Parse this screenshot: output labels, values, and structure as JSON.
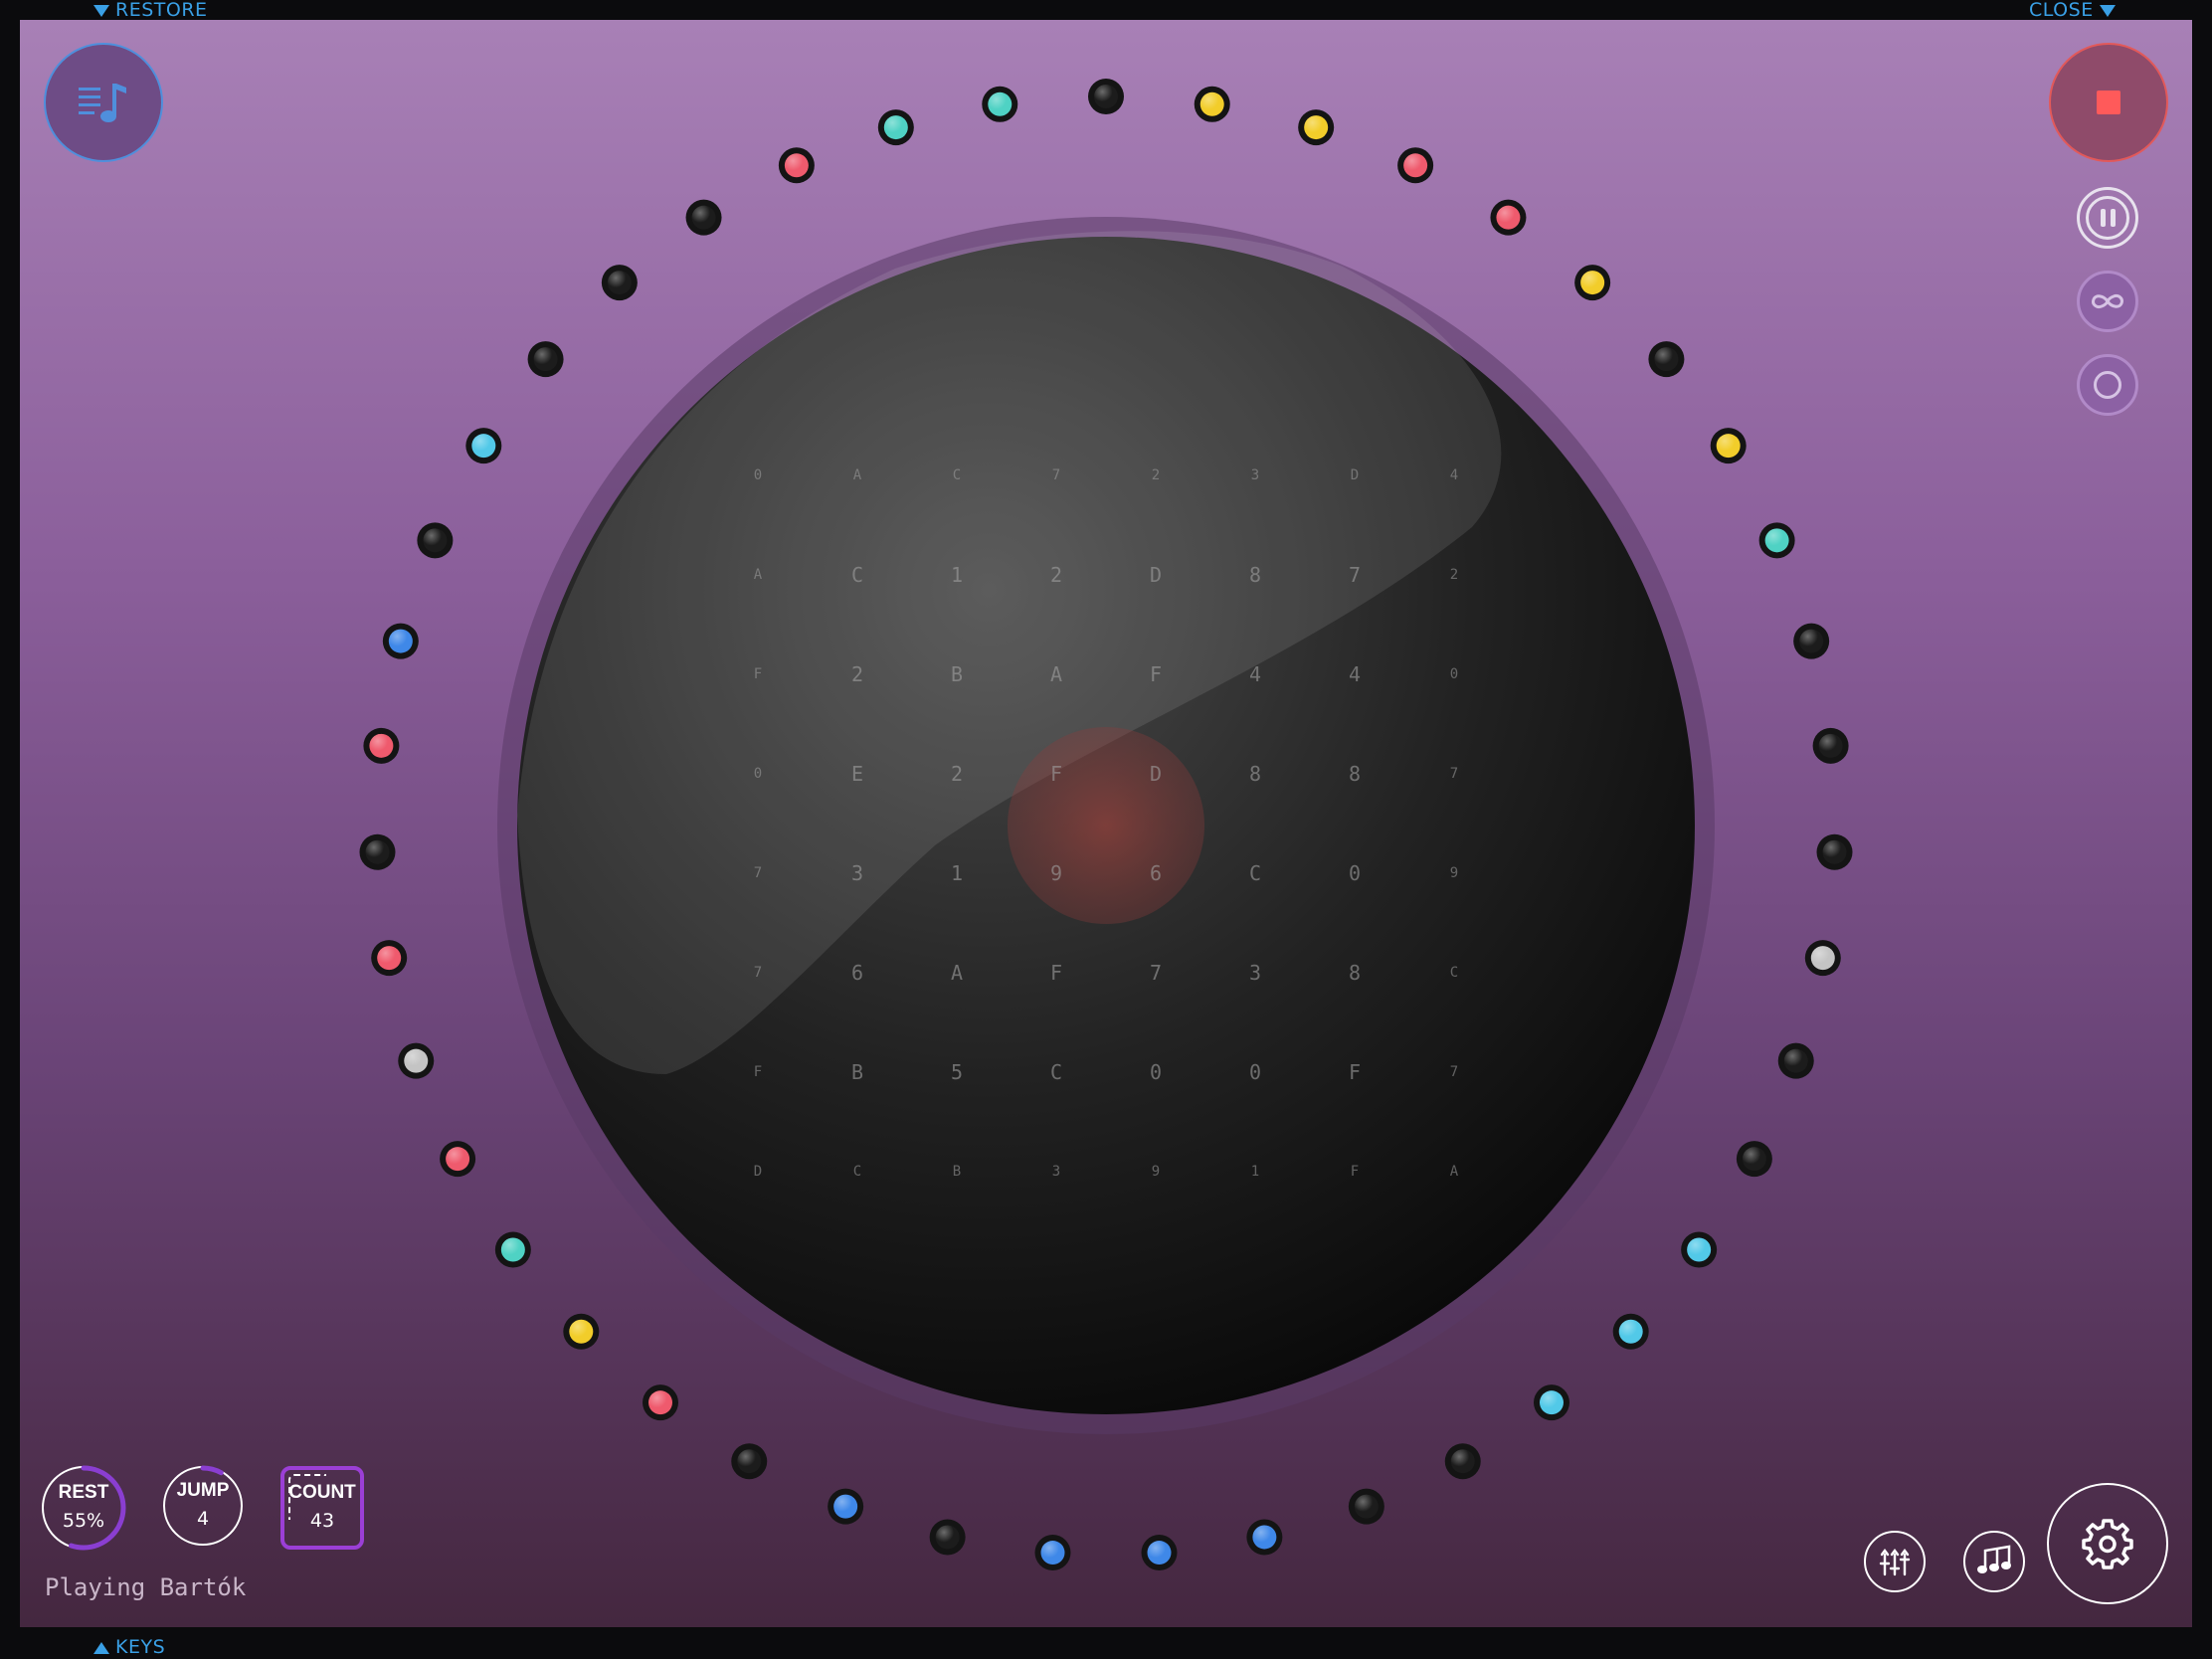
{
  "window": {
    "restore_label": "RESTORE",
    "close_label": "CLOSE",
    "keys_label": "KEYS"
  },
  "status": {
    "text": "Playing Bartók"
  },
  "stats": {
    "rest": {
      "label": "REST",
      "value": "55%",
      "progress": 0.55
    },
    "jump": {
      "label": "JUMP",
      "value": "4",
      "progress": 0.08
    },
    "count": {
      "label": "COUNT",
      "value": "43"
    }
  },
  "icons": {
    "playlist": "playlist-icon",
    "stop": "stop-icon",
    "pause": "pause-icon",
    "loop": "infinity-icon",
    "record": "record-circle-icon",
    "mixer": "mixer-sliders-icon",
    "notes": "music-notes-icon",
    "settings": "gear-icon"
  },
  "colors": {
    "accent_blue": "#3aa0e6",
    "stop_red": "#ff5a5a",
    "count_purple": "#9b3fd6",
    "dot_black": "#1c1c1c",
    "dot_teal": "#4fd2c4",
    "dot_yellow": "#f2cd2a",
    "dot_red": "#ef5a6d",
    "dot_blue": "#3f88e8",
    "dot_cyan": "#52c9e8",
    "dot_gray": "#c4c4c4"
  },
  "sequencer": {
    "dots": [
      "black",
      "yellow",
      "yellow",
      "red",
      "red",
      "yellow",
      "black",
      "yellow",
      "teal",
      "black",
      "black",
      "black",
      "gray",
      "black",
      "black",
      "cyan",
      "cyan",
      "cyan",
      "black",
      "black",
      "blue",
      "blue",
      "blue",
      "black",
      "blue",
      "black",
      "red",
      "yellow",
      "teal",
      "red",
      "gray",
      "red",
      "black",
      "red",
      "blue",
      "black",
      "cyan",
      "black",
      "black",
      "black",
      "red",
      "teal",
      "teal"
    ],
    "grid": [
      [
        "0",
        "A",
        "C",
        "7",
        "2",
        "3",
        "D",
        "4"
      ],
      [
        "A",
        "C",
        "1",
        "2",
        "D",
        "8",
        "7",
        "2"
      ],
      [
        "F",
        "2",
        "B",
        "A",
        "F",
        "4",
        "4",
        "0"
      ],
      [
        "0",
        "E",
        "2",
        "F",
        "D",
        "8",
        "8",
        "7"
      ],
      [
        "7",
        "3",
        "1",
        "9",
        "6",
        "C",
        "0",
        "9"
      ],
      [
        "7",
        "6",
        "A",
        "F",
        "7",
        "3",
        "8",
        "C"
      ],
      [
        "F",
        "B",
        "5",
        "C",
        "0",
        "0",
        "F",
        "7"
      ],
      [
        "D",
        "C",
        "B",
        "3",
        "9",
        "1",
        "F",
        "A"
      ]
    ]
  }
}
